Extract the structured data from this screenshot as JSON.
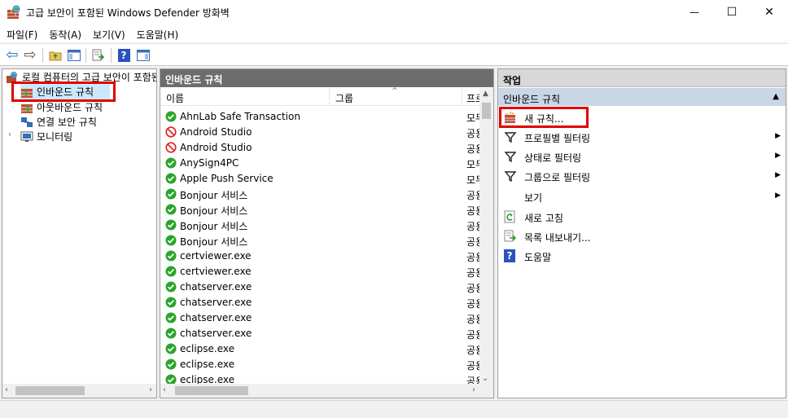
{
  "window": {
    "title": "고급 보안이 포함된 Windows Defender 방화벽",
    "minimize_glyph": "—",
    "maximize_glyph": "☐",
    "close_glyph": "✕"
  },
  "menu": [
    "파일(F)",
    "동작(A)",
    "보기(V)",
    "도움말(H)"
  ],
  "toolbar": {
    "back_glyph": "⇦",
    "forward_glyph": "⇨",
    "help_glyph": "?"
  },
  "tree": {
    "root_label": "로컬 컴퓨터의 고급 보안이 포함된 Windows Defender 방화벽",
    "items": [
      {
        "label": "인바운드 규칙",
        "icon": "inbound-rules-icon",
        "selected": true
      },
      {
        "label": "아웃바운드 규칙",
        "icon": "outbound-rules-icon"
      },
      {
        "label": "연결 보안 규칙",
        "icon": "connection-security-icon"
      },
      {
        "label": "모니터링",
        "icon": "monitoring-icon",
        "expandable": true
      }
    ]
  },
  "middle": {
    "header": "인바운드 규칙",
    "columns": [
      "이름",
      "그룹",
      "프로필"
    ],
    "rows": [
      {
        "name": "AhnLab Safe Transaction",
        "status": "allow",
        "profile": "모두"
      },
      {
        "name": "Android Studio",
        "status": "block",
        "profile": "공용"
      },
      {
        "name": "Android Studio",
        "status": "block",
        "profile": "공용"
      },
      {
        "name": "AnySign4PC",
        "status": "allow",
        "profile": "모두"
      },
      {
        "name": "Apple Push Service",
        "status": "allow",
        "profile": "모두"
      },
      {
        "name": "Bonjour 서비스",
        "status": "allow",
        "profile": "공용"
      },
      {
        "name": "Bonjour 서비스",
        "status": "allow",
        "profile": "공용"
      },
      {
        "name": "Bonjour 서비스",
        "status": "allow",
        "profile": "공용"
      },
      {
        "name": "Bonjour 서비스",
        "status": "allow",
        "profile": "공용"
      },
      {
        "name": "certviewer.exe",
        "status": "allow",
        "profile": "공용"
      },
      {
        "name": "certviewer.exe",
        "status": "allow",
        "profile": "공용"
      },
      {
        "name": "chatserver.exe",
        "status": "allow",
        "profile": "공용"
      },
      {
        "name": "chatserver.exe",
        "status": "allow",
        "profile": "공용"
      },
      {
        "name": "chatserver.exe",
        "status": "allow",
        "profile": "공용"
      },
      {
        "name": "chatserver.exe",
        "status": "allow",
        "profile": "공용"
      },
      {
        "name": "eclipse.exe",
        "status": "allow",
        "profile": "공용"
      },
      {
        "name": "eclipse.exe",
        "status": "allow",
        "profile": "공용"
      },
      {
        "name": "eclipse.exe",
        "status": "allow",
        "profile": "공용"
      }
    ]
  },
  "actions": {
    "header": "작업",
    "section": "인바운드 규칙",
    "items": [
      {
        "label": "새 규칙...",
        "icon": "new-rule-icon",
        "submenu": false,
        "highlighted": true
      },
      {
        "label": "프로필별 필터링",
        "icon": "filter-icon",
        "submenu": true
      },
      {
        "label": "상태로 필터링",
        "icon": "filter-icon",
        "submenu": true
      },
      {
        "label": "그룹으로 필터링",
        "icon": "filter-icon",
        "submenu": true
      },
      {
        "label": "보기",
        "icon": "",
        "submenu": true
      },
      {
        "label": "새로 고침",
        "icon": "refresh-icon",
        "submenu": false
      },
      {
        "label": "목록 내보내기...",
        "icon": "export-list-icon",
        "submenu": false
      },
      {
        "label": "도움말",
        "icon": "help-icon",
        "submenu": false
      }
    ]
  },
  "colors": {
    "allow": "#2aa52a",
    "block": "#e02020",
    "highlight_border": "#e00000",
    "pane_header": "#6d6d6d",
    "action_section": "#c9d6e6"
  }
}
